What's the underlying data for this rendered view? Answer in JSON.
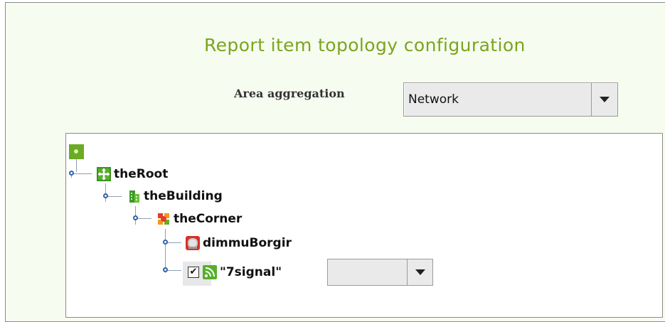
{
  "header": {
    "title": "Report item topology configuration"
  },
  "aggregation": {
    "label": "Area aggregation",
    "selected": "Network"
  },
  "tree": {
    "nodes": [
      {
        "label": "theRoot",
        "icon": "root-icon"
      },
      {
        "label": "theBuilding",
        "icon": "building-icon"
      },
      {
        "label": "theCorner",
        "icon": "corner-icon"
      },
      {
        "label": "dimmuBorgir",
        "icon": "device-icon"
      },
      {
        "label": "\"7signal\"",
        "icon": "signal-icon",
        "checked": true,
        "select_value": ""
      }
    ]
  },
  "colors": {
    "title": "#7aa51d",
    "panel_bg": "#f7fcf1",
    "accent_green": "#6cab25"
  }
}
